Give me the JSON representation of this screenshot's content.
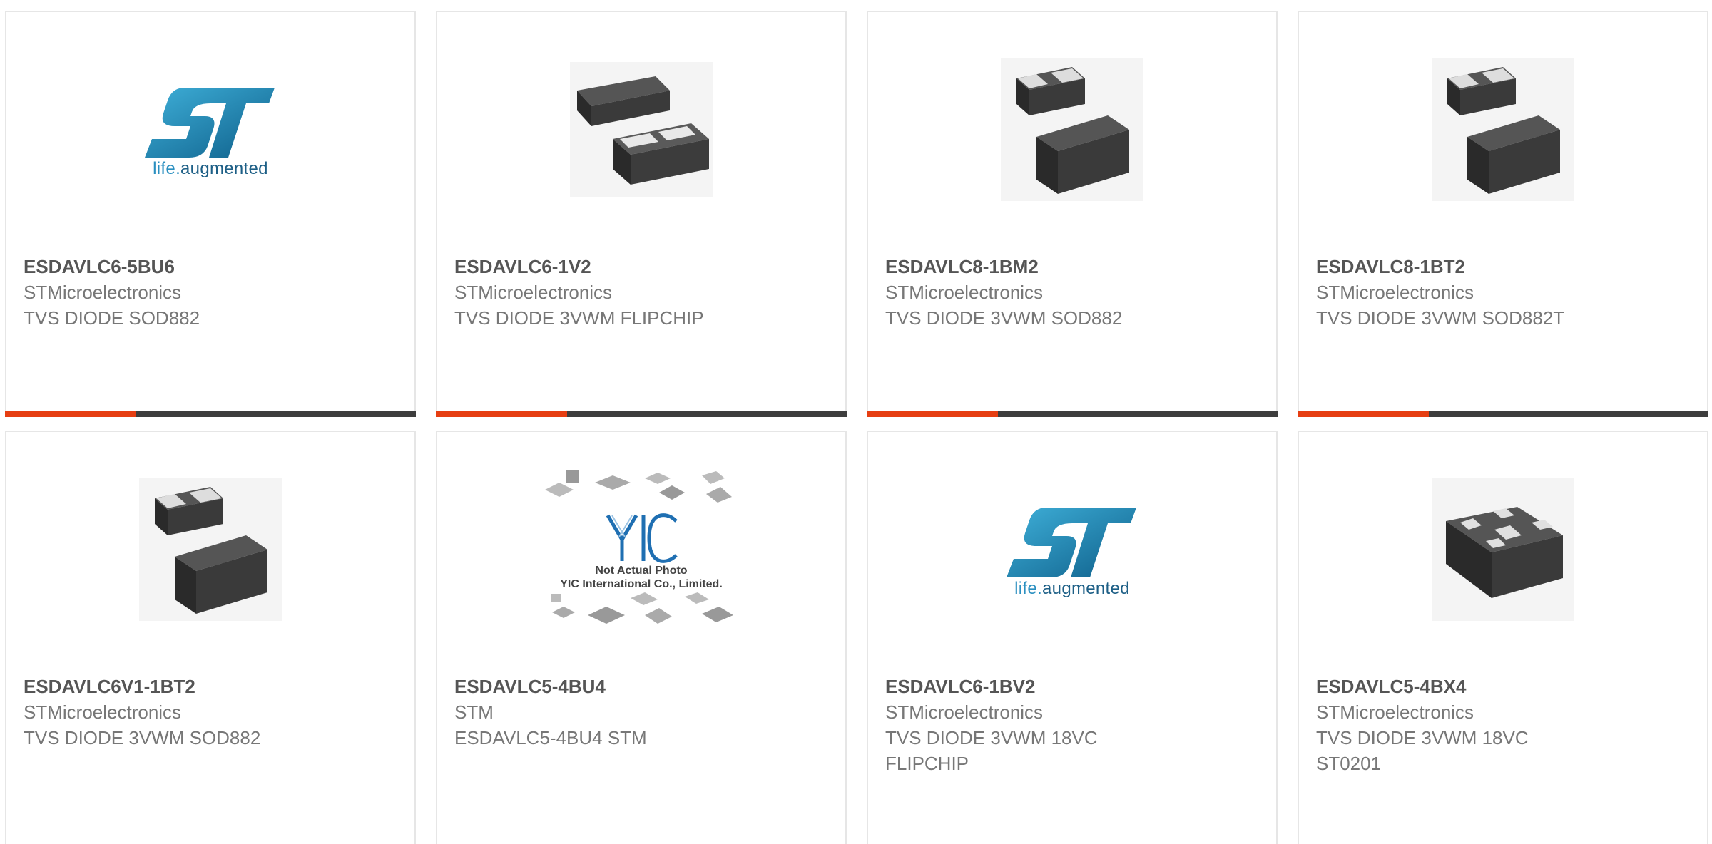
{
  "products": [
    {
      "part": "ESDAVLC6-5BU6",
      "manufacturer": "STMicroelectronics",
      "description": [
        "TVS DIODE SOD882"
      ],
      "image": "st-logo"
    },
    {
      "part": "ESDAVLC6-1V2",
      "manufacturer": "STMicroelectronics",
      "description": [
        "TVS DIODE 3VWM FLIPCHIP"
      ],
      "image": "chip-flipchip"
    },
    {
      "part": "ESDAVLC8-1BM2",
      "manufacturer": "STMicroelectronics",
      "description": [
        "TVS DIODE 3VWM SOD882"
      ],
      "image": "chip-sod882"
    },
    {
      "part": "ESDAVLC8-1BT2",
      "manufacturer": "STMicroelectronics",
      "description": [
        "TVS DIODE 3VWM SOD882T"
      ],
      "image": "chip-sod882"
    },
    {
      "part": "ESDAVLC6V1-1BT2",
      "manufacturer": "STMicroelectronics",
      "description": [
        "TVS DIODE 3VWM SOD882"
      ],
      "image": "chip-sod882"
    },
    {
      "part": "ESDAVLC5-4BU4",
      "manufacturer": "STM",
      "description": [
        "ESDAVLC5-4BU4 STM"
      ],
      "image": "not-actual-photo"
    },
    {
      "part": "ESDAVLC6-1BV2",
      "manufacturer": "STMicroelectronics",
      "description": [
        "TVS DIODE 3VWM 18VC",
        "FLIPCHIP"
      ],
      "image": "st-logo"
    },
    {
      "part": "ESDAVLC5-4BX4",
      "manufacturer": "STMicroelectronics",
      "description": [
        "TVS DIODE 3VWM 18VC",
        "ST0201"
      ],
      "image": "chip-st0201"
    }
  ],
  "logo": {
    "brand": "ST",
    "tagline_a": "life",
    "tagline_dot": ".",
    "tagline_b": "augmented"
  },
  "placeholder": {
    "line1": "Not Actual Photo",
    "line2": "YIC International Co., Limited.",
    "mark": "YIC"
  },
  "colors": {
    "accent": "#e63e12",
    "bar": "#3d3d3d",
    "logo_blue": "#2a8fc0"
  }
}
